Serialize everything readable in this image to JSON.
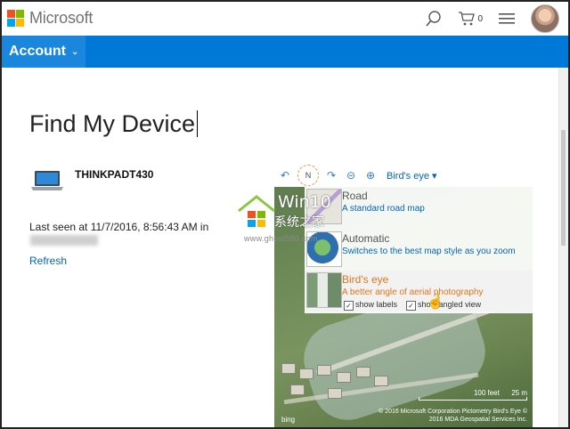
{
  "header": {
    "brand": "Microsoft",
    "cart_count": "0",
    "icons": [
      "search-icon",
      "cart-icon",
      "hamburger-menu-icon",
      "user-avatar"
    ]
  },
  "nav": {
    "account_label": "Account",
    "accent_color": "#0078d7"
  },
  "main": {
    "title": "Find My Device",
    "device_name": "THINKPADT430",
    "last_seen": "Last seen at 11/7/2016, 8:56:43 AM in",
    "refresh_label": "Refresh"
  },
  "map": {
    "toolbar": {
      "view_button": "Bird's eye",
      "compass_label": "N"
    },
    "options": [
      {
        "title": "Road",
        "desc": "A standard road map"
      },
      {
        "title": "Automatic",
        "desc": "Switches to the best map style as you zoom"
      },
      {
        "title": "Bird's eye",
        "desc": "A better angle of aerial photography"
      }
    ],
    "checks": {
      "show_labels": "show labels",
      "show_angled": "show angled view"
    },
    "scale_feet": "100 feet",
    "scale_m": "25 m",
    "copyright1": "© 2016 Microsoft Corporation   Pictometry Bird's Eye ©",
    "copyright2": "2016 MDA Geospatial Services Inc.",
    "bing": "bing"
  },
  "watermark": {
    "line1": "Win10",
    "line2": "系统之家",
    "url": "www.ghost580.com"
  }
}
